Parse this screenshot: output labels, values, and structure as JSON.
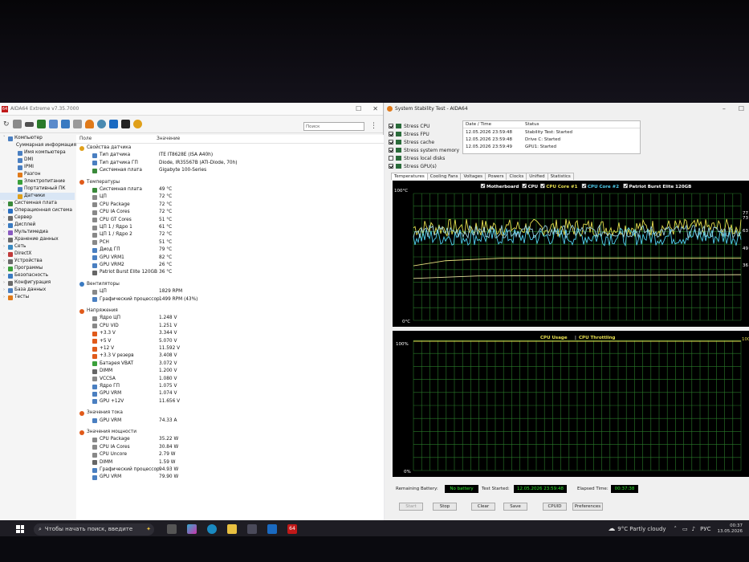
{
  "aida": {
    "title": "AIDA64 Extreme v7.35.7000",
    "search_placeholder": "Поиск",
    "col_field": "Поле",
    "col_value": "Значение",
    "tree": [
      {
        "label": "Компьютер",
        "level": 0,
        "color": "#4a7fc1"
      },
      {
        "label": "Суммарная информация",
        "level": 1,
        "color": "#4a7fc1"
      },
      {
        "label": "Имя компьютера",
        "level": 1,
        "color": "#4a7fc1"
      },
      {
        "label": "DMI",
        "level": 1,
        "color": "#4a7fc1"
      },
      {
        "label": "IPMI",
        "level": 1,
        "color": "#4a7fc1"
      },
      {
        "label": "Разгон",
        "level": 1,
        "color": "#e07a1a"
      },
      {
        "label": "Электропитание",
        "level": 1,
        "color": "#3aa03a"
      },
      {
        "label": "Портативный ПК",
        "level": 1,
        "color": "#4a7fc1"
      },
      {
        "label": "Датчики",
        "level": 1,
        "color": "#e0a01a"
      },
      {
        "label": "Системная плата",
        "level": 0,
        "color": "#3a8a3a"
      },
      {
        "label": "Операционная система",
        "level": 0,
        "color": "#2a6fc1"
      },
      {
        "label": "Сервер",
        "level": 0,
        "color": "#6a6a6a"
      },
      {
        "label": "Дисплей",
        "level": 0,
        "color": "#3a7ac1"
      },
      {
        "label": "Мультимедиа",
        "level": 0,
        "color": "#8a5ac1"
      },
      {
        "label": "Хранение данных",
        "level": 0,
        "color": "#6a6a6a"
      },
      {
        "label": "Сеть",
        "level": 0,
        "color": "#3a8ac1"
      },
      {
        "label": "DirectX",
        "level": 0,
        "color": "#c13a3a"
      },
      {
        "label": "Устройства",
        "level": 0,
        "color": "#6a6a6a"
      },
      {
        "label": "Программы",
        "level": 0,
        "color": "#3aa03a"
      },
      {
        "label": "Безопасность",
        "level": 0,
        "color": "#3a7ac1"
      },
      {
        "label": "Конфигурация",
        "level": 0,
        "color": "#6a6a6a"
      },
      {
        "label": "База данных",
        "level": 0,
        "color": "#4a7fc1"
      },
      {
        "label": "Тесты",
        "level": 0,
        "color": "#e07a1a"
      }
    ],
    "rows": [
      {
        "type": "sec",
        "field": "Свойства датчика",
        "value": "",
        "color": "#e0a01a"
      },
      {
        "type": "row",
        "field": "Тип датчика",
        "value": "ITE IT8628E  (ISA A40h)",
        "color": "#4a7fc1"
      },
      {
        "type": "row",
        "field": "Тип датчика ГП",
        "value": "Diode, IR35567B  (ATI-Diode, 70h)",
        "color": "#4a7fc1"
      },
      {
        "type": "row",
        "field": "Системная плата",
        "value": "Gigabyte 100-Series",
        "color": "#3a8a3a"
      },
      {
        "type": "gap"
      },
      {
        "type": "sec",
        "field": "Температуры",
        "value": "",
        "color": "#e05a1a"
      },
      {
        "type": "row",
        "field": "Системная плата",
        "value": "49 °C",
        "color": "#3a8a3a"
      },
      {
        "type": "row",
        "field": "ЦП",
        "value": "72 °C",
        "color": "#888"
      },
      {
        "type": "row",
        "field": "CPU Package",
        "value": "72 °C",
        "color": "#888"
      },
      {
        "type": "row",
        "field": "CPU IA Cores",
        "value": "72 °C",
        "color": "#888"
      },
      {
        "type": "row",
        "field": "CPU GT Cores",
        "value": "51 °C",
        "color": "#888"
      },
      {
        "type": "row",
        "field": "ЦП 1 / Ядро 1",
        "value": "61 °C",
        "color": "#888"
      },
      {
        "type": "row",
        "field": "ЦП 1 / Ядро 2",
        "value": "72 °C",
        "color": "#888"
      },
      {
        "type": "row",
        "field": "PCH",
        "value": "51 °C",
        "color": "#888"
      },
      {
        "type": "row",
        "field": "Диод ГП",
        "value": "79 °C",
        "color": "#4a7fc1"
      },
      {
        "type": "row",
        "field": "GPU VRM1",
        "value": "82 °C",
        "color": "#4a7fc1"
      },
      {
        "type": "row",
        "field": "GPU VRM2",
        "value": "26 °C",
        "color": "#4a7fc1"
      },
      {
        "type": "row",
        "field": "Patriot Burst Elite 120GB",
        "value": "36 °C",
        "color": "#666"
      },
      {
        "type": "gap"
      },
      {
        "type": "sec",
        "field": "Вентиляторы",
        "value": "",
        "color": "#3a7ac1"
      },
      {
        "type": "row",
        "field": "ЦП",
        "value": "1829 RPM",
        "color": "#888"
      },
      {
        "type": "row",
        "field": "Графический процессор",
        "value": "1499 RPM  (43%)",
        "color": "#4a7fc1"
      },
      {
        "type": "gap"
      },
      {
        "type": "sec",
        "field": "Напряжения",
        "value": "",
        "color": "#e05a1a"
      },
      {
        "type": "row",
        "field": "Ядро ЦП",
        "value": "1.248 V",
        "color": "#888"
      },
      {
        "type": "row",
        "field": "CPU VID",
        "value": "1.251 V",
        "color": "#888"
      },
      {
        "type": "row",
        "field": "+3.3 V",
        "value": "3.344 V",
        "color": "#e05a1a"
      },
      {
        "type": "row",
        "field": "+5 V",
        "value": "5.070 V",
        "color": "#e05a1a"
      },
      {
        "type": "row",
        "field": "+12 V",
        "value": "11.592 V",
        "color": "#e05a1a"
      },
      {
        "type": "row",
        "field": "+3.3 V резерв",
        "value": "3.408 V",
        "color": "#e05a1a"
      },
      {
        "type": "row",
        "field": "Батарея VBAT",
        "value": "3.072 V",
        "color": "#3aa03a"
      },
      {
        "type": "row",
        "field": "DIMM",
        "value": "1.200 V",
        "color": "#666"
      },
      {
        "type": "row",
        "field": "VCCSA",
        "value": "1.080 V",
        "color": "#888"
      },
      {
        "type": "row",
        "field": "Ядро ГП",
        "value": "1.075 V",
        "color": "#4a7fc1"
      },
      {
        "type": "row",
        "field": "GPU VRM",
        "value": "1.074 V",
        "color": "#4a7fc1"
      },
      {
        "type": "row",
        "field": "GPU +12V",
        "value": "11.656 V",
        "color": "#4a7fc1"
      },
      {
        "type": "gap"
      },
      {
        "type": "sec",
        "field": "Значения тока",
        "value": "",
        "color": "#e05a1a"
      },
      {
        "type": "row",
        "field": "GPU VRM",
        "value": "74.33 A",
        "color": "#4a7fc1"
      },
      {
        "type": "gap"
      },
      {
        "type": "sec",
        "field": "Значения мощности",
        "value": "",
        "color": "#e05a1a"
      },
      {
        "type": "row",
        "field": "CPU Package",
        "value": "35.22 W",
        "color": "#888"
      },
      {
        "type": "row",
        "field": "CPU IA Cores",
        "value": "30.84 W",
        "color": "#888"
      },
      {
        "type": "row",
        "field": "CPU Uncore",
        "value": "2.79 W",
        "color": "#888"
      },
      {
        "type": "row",
        "field": "DIMM",
        "value": "1.59 W",
        "color": "#666"
      },
      {
        "type": "row",
        "field": "Графический процессор",
        "value": "94.93 W",
        "color": "#4a7fc1"
      },
      {
        "type": "row",
        "field": "GPU VRM",
        "value": "79.90 W",
        "color": "#4a7fc1"
      }
    ]
  },
  "sst": {
    "title": "System Stability Test - AIDA64",
    "stress": [
      {
        "label": "Stress CPU",
        "checked": true
      },
      {
        "label": "Stress FPU",
        "checked": true
      },
      {
        "label": "Stress cache",
        "checked": true
      },
      {
        "label": "Stress system memory",
        "checked": true
      },
      {
        "label": "Stress local disks",
        "checked": false
      },
      {
        "label": "Stress GPU(s)",
        "checked": true
      }
    ],
    "log_headers": {
      "date": "Date / Time",
      "status": "Status"
    },
    "log": [
      {
        "date": "12.05.2026 23:59:48",
        "status": "Stability Test: Started"
      },
      {
        "date": "12.05.2026 23:59:48",
        "status": "Drive C: Started"
      },
      {
        "date": "12.05.2026 23:59:49",
        "status": "GPU1: Started"
      }
    ],
    "tabs": [
      "Temperatures",
      "Cooling Fans",
      "Voltages",
      "Powers",
      "Clocks",
      "Unified",
      "Statistics"
    ],
    "temp_legend": [
      {
        "label": "Motherboard",
        "color": "#ffffff"
      },
      {
        "label": "CPU",
        "color": "#ffffff"
      },
      {
        "label": "CPU Core #1",
        "color": "#e8e050"
      },
      {
        "label": "CPU Core #2",
        "color": "#50d0f0"
      },
      {
        "label": "Patriot Burst Elite 120GB",
        "color": "#ffffff"
      }
    ],
    "temp_axis": {
      "top": "100°C",
      "bottom": "0°C"
    },
    "temp_right": [
      "77",
      "73",
      "63",
      "49",
      "36"
    ],
    "usage_legend": {
      "a": "CPU Usage",
      "sep": "|",
      "b": "CPU Throttling"
    },
    "usage_axis": {
      "top": "100%",
      "bottom": "0%",
      "right_top": "100%"
    },
    "remaining_battery_label": "Remaining Battery:",
    "remaining_battery_value": "No battery",
    "test_started_label": "Test Started:",
    "test_started_value": "12.05.2026 23:59:48",
    "elapsed_label": "Elapsed Time:",
    "elapsed_value": "00:37:38",
    "buttons": {
      "start": "Start",
      "stop": "Stop",
      "clear": "Clear",
      "save": "Save",
      "cpuid": "CPUID",
      "prefs": "Preferences"
    }
  },
  "taskbar": {
    "search_placeholder": "Чтобы начать поиск, введите",
    "weather": "9°C  Partly cloudy",
    "lang": "РУС",
    "time": "00:37",
    "date": "13.05.2026"
  }
}
